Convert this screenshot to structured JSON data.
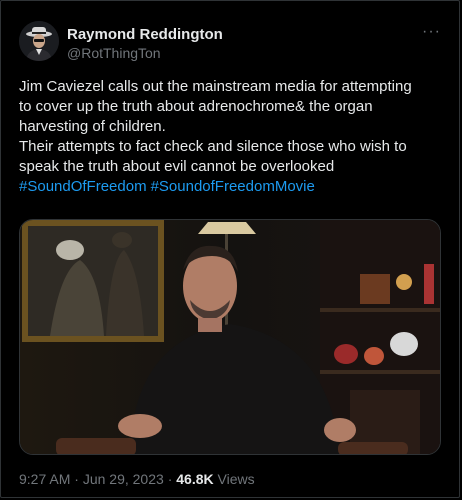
{
  "tweet": {
    "author": {
      "display_name": "Raymond Reddington",
      "handle": "@RotThingTon",
      "avatar_icon": "avatar-man-in-fedora"
    },
    "more_icon": "more-horizontal-icon",
    "body_lines": [
      "Jim Caviezel calls out the mainstream media for attempting",
      "to cover up the truth about adrenochrome& the organ",
      "harvesting of children.",
      "Their attempts to fact check and silence those who wish to",
      "speak the truth about evil cannot be overlooked"
    ],
    "hashtags": [
      "#SoundOfFreedom",
      "#SoundofFreedomMovie"
    ],
    "media_description_icon": "video-thumbnail",
    "time": "9:27 AM",
    "separator": "·",
    "date": "Jun 29, 2023",
    "views_count": "46.8K",
    "views_label": "Views"
  },
  "colors": {
    "background": "#000000",
    "text": "#e7e9ea",
    "secondary": "#71767b",
    "link": "#1d9bf0",
    "border": "#2f3336"
  }
}
